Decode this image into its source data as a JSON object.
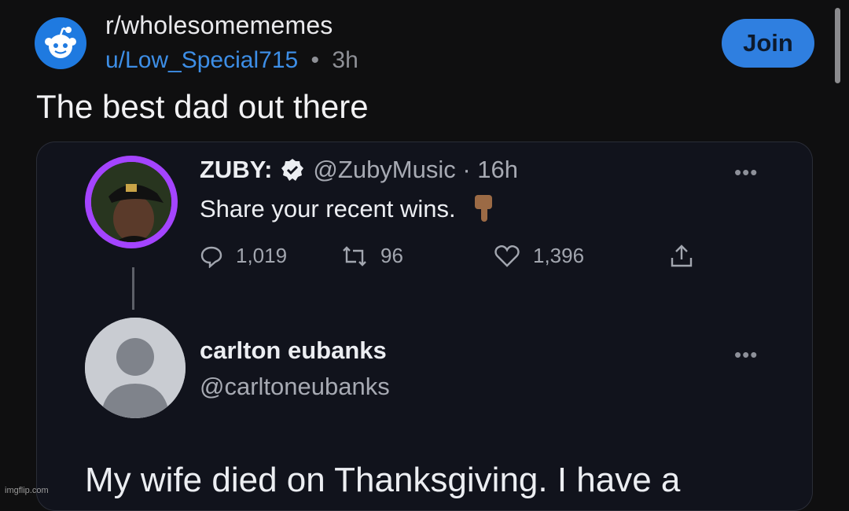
{
  "header": {
    "subreddit": "r/wholesomememes",
    "username": "u/Low_Special715",
    "separator": "•",
    "time": "3h",
    "join_label": "Join"
  },
  "post": {
    "title": "The best dad out there"
  },
  "tweet1": {
    "name": "ZUBY:",
    "handle_time": "@ZubyMusic · 16h",
    "text": "Share your recent wins.",
    "emoji_icon": "pointing-down-icon",
    "replies": "1,019",
    "retweets": "96",
    "likes": "1,396",
    "more": "•••"
  },
  "tweet2": {
    "name": "carlton eubanks",
    "handle": "@carltoneubanks",
    "body": "My wife died on Thanksgiving. I have a",
    "more": "•••"
  },
  "watermark": "imgflip.com",
  "colors": {
    "background": "#0f0f10",
    "accent": "#2f7fe0",
    "username": "#3d8ee6",
    "card": "#11131c"
  }
}
